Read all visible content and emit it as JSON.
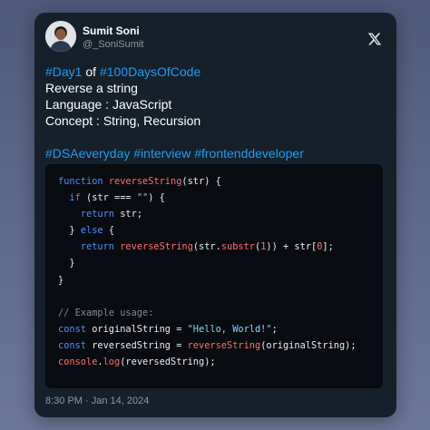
{
  "author": {
    "name": "Sumit Soni",
    "handle": "@_SoniSumit",
    "avatar_icon": "avatar-icon",
    "platform_icon": "x-logo-icon"
  },
  "tweet": {
    "line1": [
      {
        "text": "#Day1",
        "type": "hashtag"
      },
      {
        "text": " of ",
        "type": "text"
      },
      {
        "text": "#100DaysOfCode",
        "type": "hashtag"
      }
    ],
    "line2": "Reverse a string",
    "line3": "Language : JavaScript",
    "line4": "Concept : String, Recursion",
    "hashtags": [
      "#DSAeveryday",
      "#interview",
      "#frontenddeveloper"
    ]
  },
  "code": {
    "lines": [
      [
        {
          "t": "function ",
          "c": "kw"
        },
        {
          "t": "reverseString",
          "c": "fn"
        },
        {
          "t": "(str) {",
          "c": "id"
        }
      ],
      [
        {
          "t": "  ",
          "c": "id"
        },
        {
          "t": "if",
          "c": "kw"
        },
        {
          "t": " (str === ",
          "c": "id"
        },
        {
          "t": "\"\"",
          "c": "str"
        },
        {
          "t": ") {",
          "c": "id"
        }
      ],
      [
        {
          "t": "    ",
          "c": "id"
        },
        {
          "t": "return",
          "c": "kw"
        },
        {
          "t": " str;",
          "c": "id"
        }
      ],
      [
        {
          "t": "  } ",
          "c": "id"
        },
        {
          "t": "else",
          "c": "kw"
        },
        {
          "t": " {",
          "c": "id"
        }
      ],
      [
        {
          "t": "    ",
          "c": "id"
        },
        {
          "t": "return ",
          "c": "kw"
        },
        {
          "t": "reverseString",
          "c": "fn"
        },
        {
          "t": "(str.",
          "c": "id"
        },
        {
          "t": "substr",
          "c": "fn"
        },
        {
          "t": "(",
          "c": "id"
        },
        {
          "t": "1",
          "c": "num"
        },
        {
          "t": ")) + str[",
          "c": "id"
        },
        {
          "t": "0",
          "c": "num"
        },
        {
          "t": "];",
          "c": "id"
        }
      ],
      [
        {
          "t": "  }",
          "c": "id"
        }
      ],
      [
        {
          "t": "}",
          "c": "id"
        }
      ],
      [],
      [
        {
          "t": "// Example usage:",
          "c": "cm"
        }
      ],
      [
        {
          "t": "const",
          "c": "kw"
        },
        {
          "t": " originalString = ",
          "c": "id"
        },
        {
          "t": "\"Hello, World!\"",
          "c": "str"
        },
        {
          "t": ";",
          "c": "id"
        }
      ],
      [
        {
          "t": "const",
          "c": "kw"
        },
        {
          "t": " reversedString = ",
          "c": "id"
        },
        {
          "t": "reverseString",
          "c": "fn"
        },
        {
          "t": "(originalString);",
          "c": "id"
        }
      ],
      [
        {
          "t": "console",
          "c": "fn"
        },
        {
          "t": ".",
          "c": "id"
        },
        {
          "t": "log",
          "c": "fn"
        },
        {
          "t": "(reversedString);",
          "c": "id"
        }
      ]
    ]
  },
  "timestamp": "8:30 PM · Jan 14, 2024",
  "colors": {
    "card_bg": "#15202b",
    "hashtag": "#1d9bf0",
    "code_bg": "#080c10",
    "keyword": "#4f8cf7",
    "function": "#ff6b6b",
    "string": "#7ed7ff",
    "comment": "#7b8996"
  }
}
